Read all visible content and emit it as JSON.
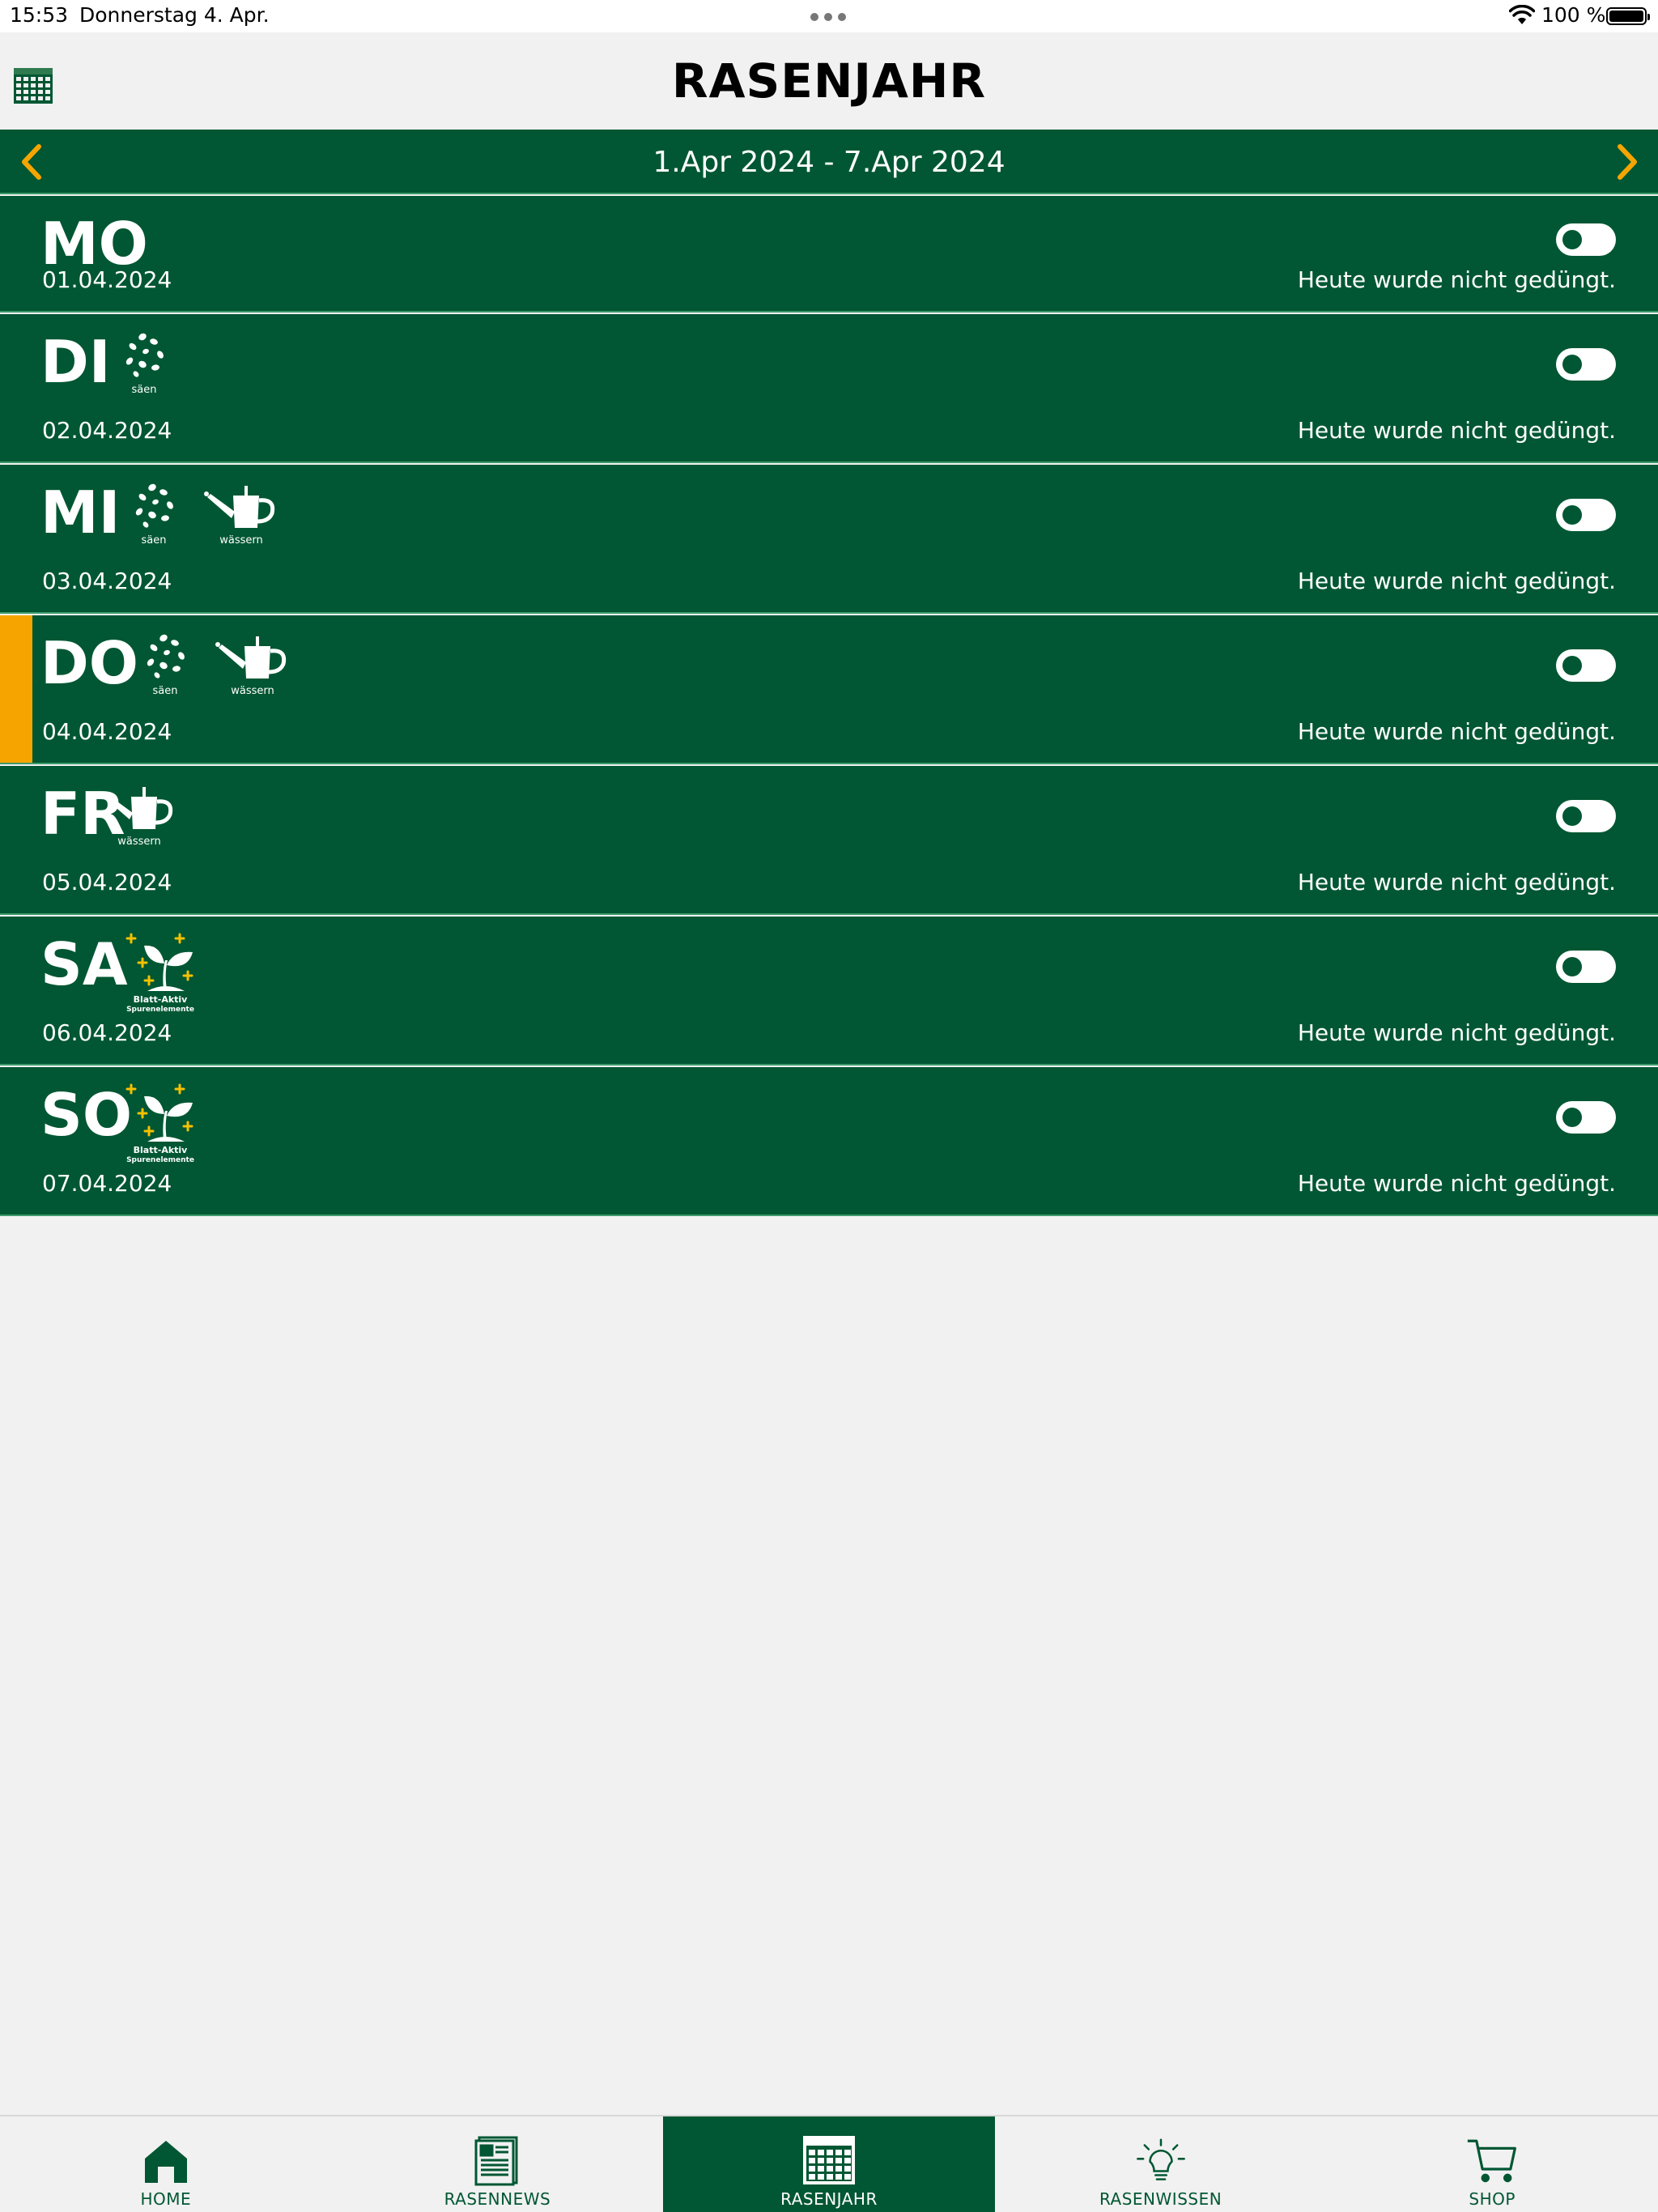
{
  "status_bar": {
    "time": "15:53",
    "date": "Donnerstag 4. Apr.",
    "battery": "100 %"
  },
  "header": {
    "title": "RASENJAHR",
    "calendar_icon": "calendar-grid-icon"
  },
  "week": {
    "range": "1.Apr 2024 - 7.Apr 2024",
    "prev_icon": "chevron-left-icon",
    "next_icon": "chevron-right-icon"
  },
  "colors": {
    "brand_green": "#015733",
    "accent_orange": "#f6a500",
    "background": "#f1f1f1"
  },
  "days": [
    {
      "code": "MO",
      "date": "01.04.2024",
      "status": "Heute wurde nicht gedüngt.",
      "today": false,
      "tasks": []
    },
    {
      "code": "DI",
      "date": "02.04.2024",
      "status": "Heute wurde nicht gedüngt.",
      "today": false,
      "tasks": [
        {
          "icon": "seeds-icon",
          "label": "säen"
        }
      ]
    },
    {
      "code": "MI",
      "date": "03.04.2024",
      "status": "Heute wurde nicht gedüngt.",
      "today": false,
      "tasks": [
        {
          "icon": "seeds-icon",
          "label": "säen"
        },
        {
          "icon": "watering-can-icon",
          "label": "wässern"
        }
      ]
    },
    {
      "code": "DO",
      "date": "04.04.2024",
      "status": "Heute wurde nicht gedüngt.",
      "today": true,
      "tasks": [
        {
          "icon": "seeds-icon",
          "label": "säen"
        },
        {
          "icon": "watering-can-icon",
          "label": "wässern"
        }
      ]
    },
    {
      "code": "FR",
      "date": "05.04.2024",
      "status": "Heute wurde nicht gedüngt.",
      "today": false,
      "tasks": [
        {
          "icon": "watering-can-icon",
          "label": "wässern"
        }
      ]
    },
    {
      "code": "SA",
      "date": "06.04.2024",
      "status": "Heute wurde nicht gedüngt.",
      "today": false,
      "tasks": [
        {
          "icon": "sprout-fertilizer-icon",
          "label": "Blatt-Aktiv",
          "sublabel": "Spurenelemente"
        }
      ]
    },
    {
      "code": "SO",
      "date": "07.04.2024",
      "status": "Heute wurde nicht gedüngt.",
      "today": false,
      "tasks": [
        {
          "icon": "sprout-fertilizer-icon",
          "label": "Blatt-Aktiv",
          "sublabel": "Spurenelemente"
        }
      ]
    }
  ],
  "tabs": [
    {
      "label": "HOME",
      "icon": "house-icon",
      "active": false
    },
    {
      "label": "RASENNEWS",
      "icon": "newspaper-icon",
      "active": false
    },
    {
      "label": "RASENJAHR",
      "icon": "calendar-grid-icon",
      "active": true
    },
    {
      "label": "RASENWISSEN",
      "icon": "lightbulb-icon",
      "active": false
    },
    {
      "label": "SHOP",
      "icon": "cart-icon",
      "active": false
    }
  ]
}
